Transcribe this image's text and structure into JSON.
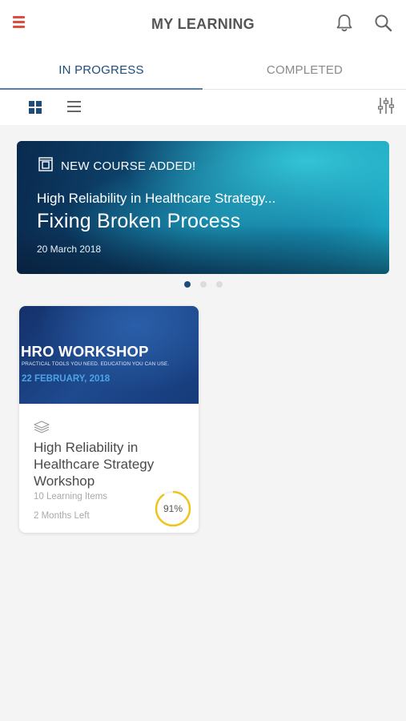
{
  "header": {
    "title": "MY LEARNING",
    "menu_icon": "hamburger-menu-icon",
    "bell_icon": "bell-icon",
    "search_icon": "search-icon",
    "accent_color": "#e04b3b"
  },
  "tabs": [
    {
      "label": "IN PROGRESS",
      "active": true
    },
    {
      "label": "COMPLETED",
      "active": false
    }
  ],
  "view_toolbar": {
    "grid_icon": "grid-view-icon",
    "list_icon": "list-view-icon",
    "filter_icon": "filter-sliders-icon",
    "selected_view": "grid"
  },
  "banner": {
    "flag": "NEW COURSE ADDED!",
    "subtitle": "High Reliability in Healthcare Strategy...",
    "title": "Fixing Broken Process",
    "date": "20 March 2018",
    "flag_icon": "course-badge-icon"
  },
  "carousel": {
    "total": 3,
    "active_index": 0
  },
  "courses": [
    {
      "thumb_title": "HRO WORKSHOP",
      "thumb_tagline": "PRACTICAL TOOLS YOU NEED. EDUCATION YOU CAN USE.",
      "thumb_date": "22 FEBRUARY, 2018",
      "type_icon": "layers-icon",
      "title": "High Reliability in Healthcare Strategy Workshop",
      "items": "10 Learning Items",
      "time_left": "2 Months Left",
      "progress_label": "91%",
      "progress": 0.91,
      "progress_color": "#f2c318"
    }
  ],
  "colors": {
    "primary": "#1d4c7a",
    "background": "#f4f4f4"
  }
}
